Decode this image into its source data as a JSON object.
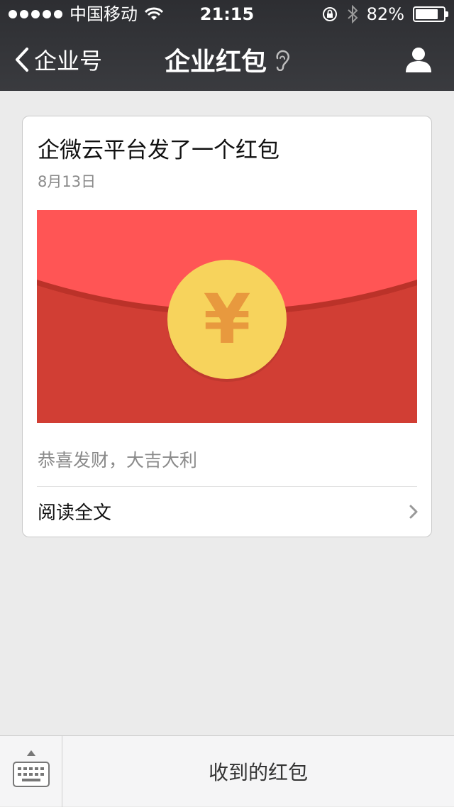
{
  "status_bar": {
    "carrier": "中国移动",
    "time": "21:15",
    "battery_percent_text": "82%",
    "battery_level": 0.82
  },
  "nav": {
    "back_label": "企业号",
    "title": "企业红包"
  },
  "card": {
    "title": "企微云平台发了一个红包",
    "date": "8月13日",
    "banner_symbol": "¥",
    "description": "恭喜发财，大吉大利",
    "read_more": "阅读全文"
  },
  "bottom": {
    "menu_label": "收到的红包"
  },
  "colors": {
    "header_bg": "#333438",
    "envelope_top": "#ff5555",
    "envelope_bottom": "#d13e34",
    "coin": "#f7d35c",
    "coin_symbol": "#e8993e"
  },
  "icons": [
    "wifi-icon",
    "lock-rotation-icon",
    "bluetooth-icon",
    "battery-icon",
    "back-chevron-icon",
    "ear-icon",
    "profile-icon",
    "chevron-right-icon",
    "keyboard-icon"
  ]
}
